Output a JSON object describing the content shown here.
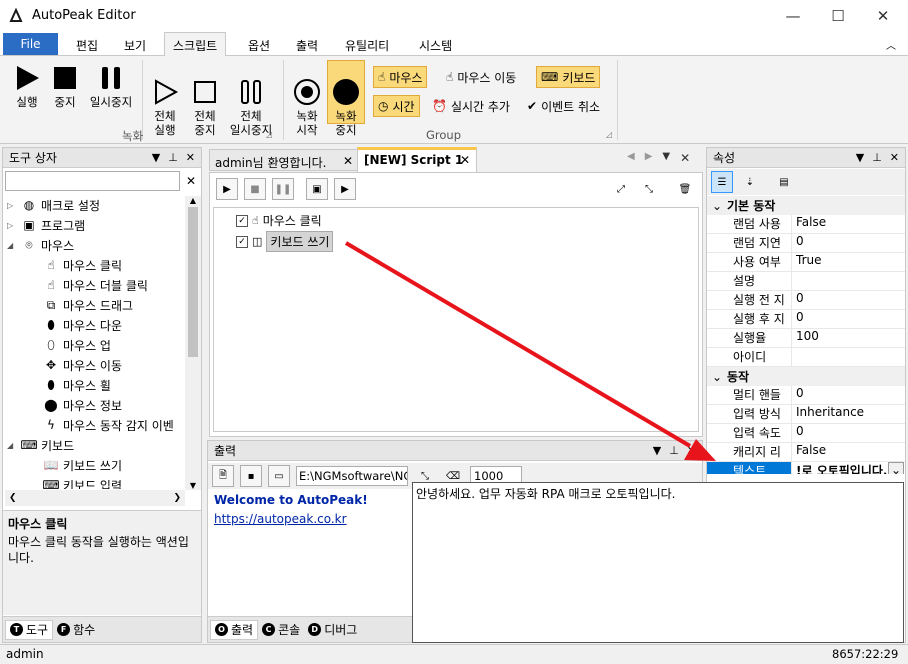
{
  "window": {
    "title": "AutoPeak Editor",
    "minimize": "—",
    "maximize": "☐",
    "close": "✕"
  },
  "menu": {
    "file": "File",
    "tabs": [
      "편집",
      "보기",
      "스크립트",
      "옵션",
      "출력",
      "유틸리티",
      "시스템"
    ],
    "active_tab": "스크립트"
  },
  "ribbon": {
    "record_group": {
      "label": "녹화",
      "buttons": [
        {
          "label": "실행",
          "icon": "play-icon"
        },
        {
          "label": "중지",
          "icon": "stop-icon"
        },
        {
          "label": "일시중지",
          "icon": "pause-icon"
        },
        {
          "label": "전체\n실행",
          "icon": "play-outline-icon"
        },
        {
          "label": "전체\n중지",
          "icon": "stop-outline-icon"
        },
        {
          "label": "전체\n일시중지",
          "icon": "pause-outline-icon"
        }
      ]
    },
    "group2": {
      "label": "Group",
      "buttons": [
        {
          "label": "녹화\n시작",
          "icon": "record-icon"
        },
        {
          "label": "녹화\n중지",
          "icon": "record-stop-icon"
        }
      ],
      "small": [
        {
          "label": "마우스",
          "icon": "mouse-click-icon",
          "highlight": true
        },
        {
          "label": "마우스 이동",
          "icon": "mouse-move-icon",
          "highlight": false
        },
        {
          "label": "키보드",
          "icon": "keyboard-icon",
          "highlight": true
        },
        {
          "label": "시간",
          "icon": "clock-icon",
          "highlight": true
        },
        {
          "label": "실시간 추가",
          "icon": "alarm-icon",
          "highlight": false
        },
        {
          "label": "이벤트 취소",
          "icon": "check-circle-icon",
          "highlight": false
        }
      ]
    }
  },
  "toolbox": {
    "title": "도구 상자",
    "search_value": "",
    "items": [
      {
        "label": "매크로 설정",
        "level": 0,
        "expander": "▷",
        "icon": "globe-icon",
        "glyph": "◍"
      },
      {
        "label": "프로그램",
        "level": 0,
        "expander": "▷",
        "icon": "program-icon",
        "glyph": "▣"
      },
      {
        "label": "마우스",
        "level": 0,
        "expander": "◢",
        "icon": "mouse-icon",
        "glyph": "⌾"
      },
      {
        "label": "마우스 클릭",
        "level": 1,
        "expander": "",
        "icon": "mouse-click-icon",
        "glyph": "☝"
      },
      {
        "label": "마우스 더블 클릭",
        "level": 1,
        "expander": "",
        "icon": "mouse-double-click-icon",
        "glyph": "☝"
      },
      {
        "label": "마우스 드래그",
        "level": 1,
        "expander": "",
        "icon": "mouse-drag-icon",
        "glyph": "⧉"
      },
      {
        "label": "마우스 다운",
        "level": 1,
        "expander": "",
        "icon": "mouse-down-icon",
        "glyph": "⬮"
      },
      {
        "label": "마우스 업",
        "level": 1,
        "expander": "",
        "icon": "mouse-up-icon",
        "glyph": "⬯"
      },
      {
        "label": "마우스 이동",
        "level": 1,
        "expander": "",
        "icon": "mouse-move-icon",
        "glyph": "✥"
      },
      {
        "label": "마우스 휠",
        "level": 1,
        "expander": "",
        "icon": "mouse-wheel-icon",
        "glyph": "⬮"
      },
      {
        "label": "마우스 정보",
        "level": 1,
        "expander": "",
        "icon": "mouse-info-icon",
        "glyph": "⬤"
      },
      {
        "label": "마우스 동작 감지 이벤",
        "level": 1,
        "expander": "",
        "icon": "lightning-icon",
        "glyph": "ϟ"
      },
      {
        "label": "키보드",
        "level": 0,
        "expander": "◢",
        "icon": "keyboard-icon",
        "glyph": "⌨"
      },
      {
        "label": "키보드 쓰기",
        "level": 1,
        "expander": "",
        "icon": "book-icon",
        "glyph": "📖"
      },
      {
        "label": "키보드 입력",
        "level": 1,
        "expander": "",
        "icon": "keyboard-input-icon",
        "glyph": "⌨"
      }
    ],
    "desc_title": "마우스 클릭",
    "desc_text": "마우스 클릭 동작을 실행하는 액션입니다.",
    "tabs": [
      {
        "letter": "T",
        "label": "도구"
      },
      {
        "letter": "F",
        "label": "함수"
      }
    ]
  },
  "editor": {
    "tabs": [
      {
        "label": "admin님 환영합니다.",
        "active": false
      },
      {
        "label": "[NEW] Script 1",
        "active": true
      }
    ],
    "script_items": [
      {
        "label": "마우스 클릭",
        "checked": true,
        "selected": false
      },
      {
        "label": "키보드 쓰기",
        "checked": true,
        "selected": true
      }
    ]
  },
  "output": {
    "title": "출력",
    "path": "E:\\NGMsoftware\\NG",
    "interval": "1000",
    "welcome": "Welcome to AutoPeak!",
    "link": "https://autopeak.co.kr",
    "tabs": [
      {
        "letter": "O",
        "label": "출력"
      },
      {
        "letter": "C",
        "label": "콘솔"
      },
      {
        "letter": "D",
        "label": "디버그"
      }
    ]
  },
  "properties": {
    "title": "속성",
    "categories": [
      {
        "name": "기본 동작",
        "rows": [
          {
            "name": "랜덤 사용",
            "value": "False"
          },
          {
            "name": "랜덤 지연",
            "value": "0"
          },
          {
            "name": "사용 여부",
            "value": "True"
          },
          {
            "name": "설명",
            "value": ""
          },
          {
            "name": "실행 전 지",
            "value": "0"
          },
          {
            "name": "실행 후 지",
            "value": "0"
          },
          {
            "name": "실행율",
            "value": "100"
          },
          {
            "name": "아이디",
            "value": ""
          }
        ]
      },
      {
        "name": "동작",
        "rows": [
          {
            "name": "멀티 핸들",
            "value": "0"
          },
          {
            "name": "입력 방식",
            "value": "Inheritance"
          },
          {
            "name": "입력 속도",
            "value": "0"
          },
          {
            "name": "캐리지 리",
            "value": "False"
          }
        ]
      }
    ],
    "selected_name": "텍스트",
    "selected_value": "!로 오토픽입니다.",
    "popup_text": "안녕하세요. 업무 자동화 RPA 매크로 오토픽입니다."
  },
  "status": {
    "user": "admin",
    "time": "8657:22:29"
  },
  "colors": {
    "accent": "#2b6cc4",
    "highlight": "#f9d97a",
    "arrow": "#e8141b",
    "selected": "#0078d7"
  }
}
